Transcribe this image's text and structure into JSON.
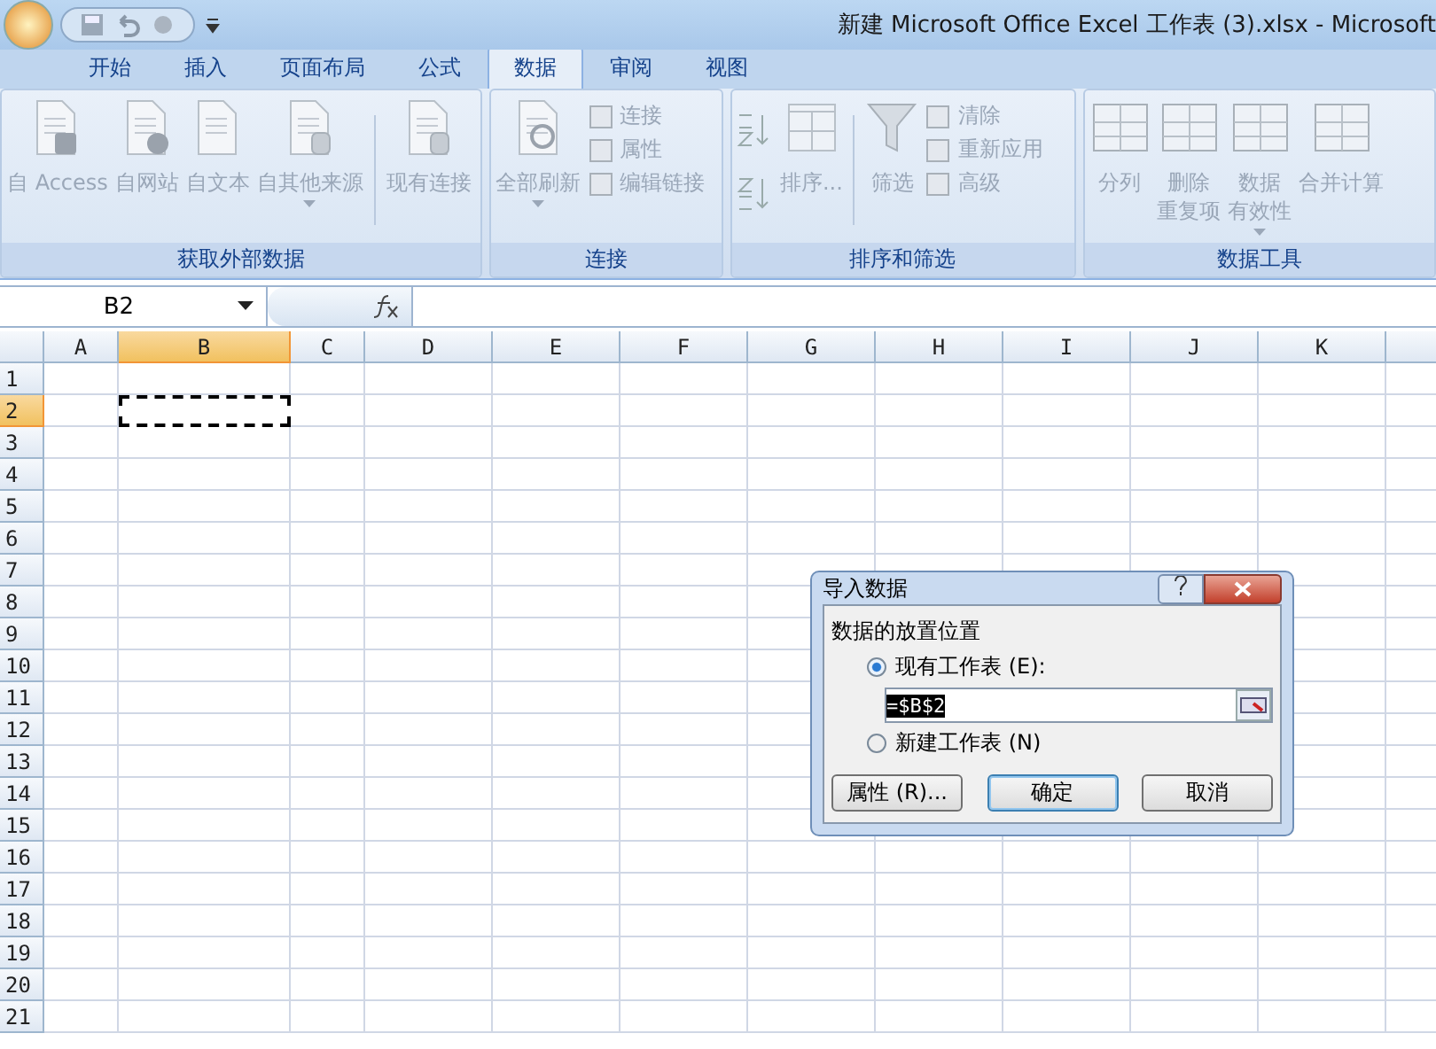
{
  "window": {
    "title": "新建 Microsoft Office Excel 工作表 (3).xlsx - Microsoft"
  },
  "tabs": [
    {
      "label": "开始",
      "selected": false
    },
    {
      "label": "插入",
      "selected": false
    },
    {
      "label": "页面布局",
      "selected": false
    },
    {
      "label": "公式",
      "selected": false
    },
    {
      "label": "数据",
      "selected": true
    },
    {
      "label": "审阅",
      "selected": false
    },
    {
      "label": "视图",
      "selected": false
    }
  ],
  "ribbon": {
    "groups": [
      {
        "label": "获取外部数据",
        "items": [
          {
            "kind": "large",
            "lines": [
              "自 Access"
            ],
            "disabled": true
          },
          {
            "kind": "large",
            "lines": [
              "自网站"
            ],
            "disabled": true
          },
          {
            "kind": "large",
            "lines": [
              "自文本"
            ],
            "disabled": true
          },
          {
            "kind": "large",
            "lines": [
              "自其他来源"
            ],
            "dropdown": true,
            "disabled": true
          },
          {
            "kind": "separator"
          },
          {
            "kind": "large",
            "lines": [
              "现有连接"
            ],
            "disabled": true
          }
        ]
      },
      {
        "label": "连接",
        "items": [
          {
            "kind": "large",
            "lines": [
              "全部刷新"
            ],
            "dropdown": true,
            "disabled": true
          },
          {
            "kind": "stack",
            "items": [
              {
                "label": "连接",
                "disabled": true
              },
              {
                "label": "属性",
                "disabled": true
              },
              {
                "label": "编辑链接",
                "disabled": true
              }
            ]
          }
        ]
      },
      {
        "label": "排序和筛选",
        "items": [
          {
            "kind": "sortpair"
          },
          {
            "kind": "large",
            "lines": [
              "排序..."
            ],
            "disabled": true
          },
          {
            "kind": "separator"
          },
          {
            "kind": "large",
            "lines": [
              "筛选"
            ],
            "disabled": true
          },
          {
            "kind": "stack",
            "items": [
              {
                "label": "清除",
                "disabled": true
              },
              {
                "label": "重新应用",
                "disabled": true
              },
              {
                "label": "高级",
                "disabled": true
              }
            ]
          }
        ]
      },
      {
        "label": "数据工具",
        "items": [
          {
            "kind": "large",
            "lines": [
              "分列"
            ],
            "disabled": true
          },
          {
            "kind": "large",
            "lines": [
              "删除",
              "重复项"
            ],
            "disabled": true
          },
          {
            "kind": "large",
            "lines": [
              "数据",
              "有效性"
            ],
            "dropdown": true,
            "disabled": true
          },
          {
            "kind": "large",
            "lines": [
              "合并计算"
            ],
            "disabled": true
          }
        ]
      }
    ]
  },
  "formula_bar": {
    "name_box": "B2"
  },
  "sheet": {
    "columns": [
      {
        "label": "A",
        "selected": false
      },
      {
        "label": "B",
        "selected": true
      },
      {
        "label": "C",
        "selected": false
      },
      {
        "label": "D",
        "selected": false
      },
      {
        "label": "E",
        "selected": false
      },
      {
        "label": "F",
        "selected": false
      },
      {
        "label": "G",
        "selected": false
      },
      {
        "label": "H",
        "selected": false
      },
      {
        "label": "I",
        "selected": false
      },
      {
        "label": "J",
        "selected": false
      },
      {
        "label": "K",
        "selected": false
      }
    ],
    "rows": [
      {
        "label": "1",
        "selected": false
      },
      {
        "label": "2",
        "selected": true
      },
      {
        "label": "3",
        "selected": false
      },
      {
        "label": "4",
        "selected": false
      },
      {
        "label": "5",
        "selected": false
      },
      {
        "label": "6",
        "selected": false
      },
      {
        "label": "7",
        "selected": false
      },
      {
        "label": "8",
        "selected": false
      },
      {
        "label": "9",
        "selected": false
      },
      {
        "label": "10",
        "selected": false
      },
      {
        "label": "11",
        "selected": false
      },
      {
        "label": "12",
        "selected": false
      },
      {
        "label": "13",
        "selected": false
      },
      {
        "label": "14",
        "selected": false
      },
      {
        "label": "15",
        "selected": false
      },
      {
        "label": "16",
        "selected": false
      },
      {
        "label": "17",
        "selected": false
      },
      {
        "label": "18",
        "selected": false
      },
      {
        "label": "19",
        "selected": false
      },
      {
        "label": "20",
        "selected": false
      },
      {
        "label": "21",
        "selected": false
      }
    ]
  },
  "dialog": {
    "title": "导入数据",
    "group_label": "数据的放置位置",
    "options": [
      {
        "label": "现有工作表 (E):",
        "selected": true
      },
      {
        "label": "新建工作表 (N)",
        "selected": false
      }
    ],
    "reference": {
      "value": "=$B$2"
    },
    "buttons": [
      {
        "label": "属性 (R)...",
        "default": false
      },
      {
        "label": "确定",
        "default": true
      },
      {
        "label": "取消",
        "default": false
      }
    ]
  }
}
